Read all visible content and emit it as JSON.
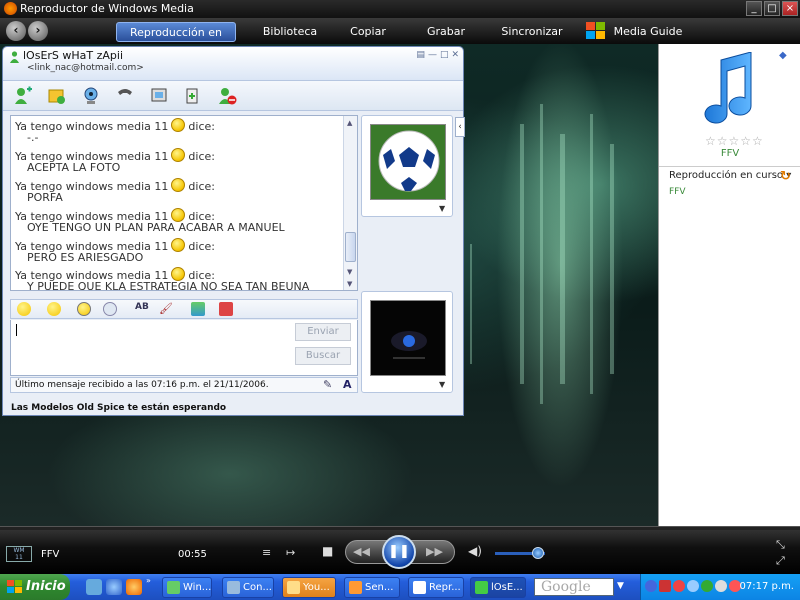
{
  "wmp": {
    "title": "Reproductor de Windows Media",
    "nav_tabs": [
      "Reproducción en curso",
      "Biblioteca",
      "Copiar",
      "Grabar",
      "Sincronizar",
      "Media Guide"
    ]
  },
  "right_panel": {
    "track": "FFV",
    "now_playing_label": "Reproducción en curso ▾",
    "playlist": [
      "FFV"
    ],
    "rating_stars": 0
  },
  "controls": {
    "track": "FFV",
    "time": "00:55",
    "volume_level": 0.85
  },
  "msn": {
    "contact_name": "lOsErS wHaT zApii",
    "contact_email": "<link_nac@hotmail.com>",
    "messages": [
      {
        "sender": "Ya tengo windows media 11",
        "says": "dice:",
        "text": "-.-"
      },
      {
        "sender": "Ya tengo windows media 11",
        "says": "dice:",
        "text": "ACEPTA LA FOTO"
      },
      {
        "sender": "Ya tengo windows media 11",
        "says": "dice:",
        "text": "PORFA"
      },
      {
        "sender": "Ya tengo windows media 11",
        "says": "dice:",
        "text": "OYE TENGO UN PLAN PARA ACABAR A MANUEL"
      },
      {
        "sender": "Ya tengo windows media 11",
        "says": "dice:",
        "text": "PERO ES ARIESGADO"
      },
      {
        "sender": "Ya tengo windows media 11",
        "says": "dice:",
        "text": "Y PUEDE QUE KLA ESTRATEGIA NO SEA TAN BEUNA"
      }
    ],
    "send_label": "Enviar",
    "search_label": "Buscar",
    "status_text": "Último mensaje recibido a las 07:16 p.m. el 21/11/2006.",
    "ad_text": "Las Modelos Old Spice te están esperando"
  },
  "taskbar": {
    "start_label": "Inicio",
    "tasks": [
      "Win...",
      "Con...",
      "You...",
      "Sen...",
      "Repr...",
      "lOsE..."
    ],
    "search_brand": "Google",
    "clock": "07:17 p.m."
  }
}
